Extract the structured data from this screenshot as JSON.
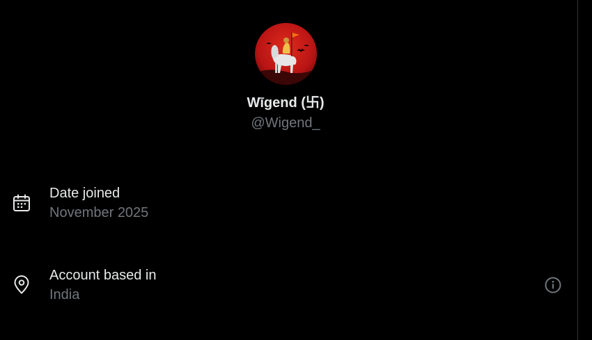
{
  "profile": {
    "display_name": "Wīgend (卐)",
    "handle": "@Wigend_",
    "avatar_icon": "profile-avatar-red-horse-rider"
  },
  "details": {
    "date_joined": {
      "icon": "calendar-icon",
      "label": "Date joined",
      "value": "November 2025"
    },
    "account_based": {
      "icon": "location-pin-icon",
      "label": "Account based in",
      "value": "India",
      "info_icon": "info-icon"
    }
  },
  "colors": {
    "background": "#000000",
    "primary_text": "#e7e9ea",
    "secondary_text": "#71767b",
    "divider": "#2f3336",
    "avatar_red": "#b81414"
  }
}
